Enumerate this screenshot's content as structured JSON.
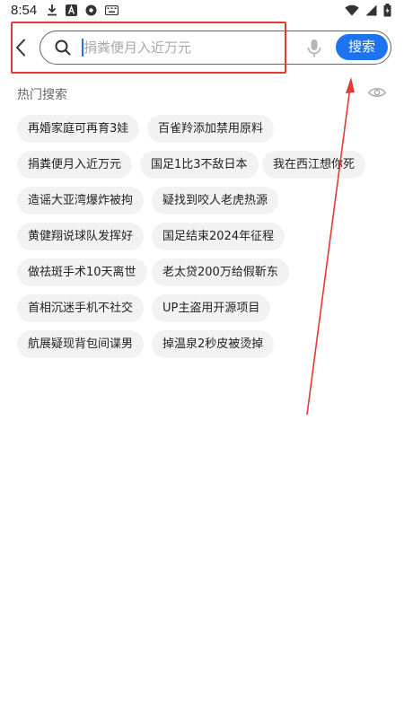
{
  "status_bar": {
    "time": "8:54",
    "left_icons": [
      "download-icon",
      "text-a-icon",
      "record-icon",
      "keyboard-icon"
    ],
    "right_icons": [
      "wifi-icon",
      "signal-icon",
      "battery-icon"
    ]
  },
  "search": {
    "placeholder": "捐粪便月入近万元",
    "value": "",
    "button_label": "搜索"
  },
  "hot_search": {
    "title": "热门搜索",
    "rows": [
      [
        "再婚家庭可再育3娃",
        "百雀羚添加禁用原料"
      ],
      [
        "捐粪便月入近万元",
        "国足1比3不敌日本",
        "我在西江想你死"
      ],
      [
        "造谣大亚湾爆炸被拘",
        "疑找到咬人老虎热源"
      ],
      [
        "黄健翔说球队发挥好",
        "国足结束2024年征程"
      ],
      [
        "做祛斑手术10天离世",
        "老太贷200万给假靳东"
      ],
      [
        "首相沉迷手机不社交",
        "UP主盗用开源项目"
      ],
      [
        "航展疑现背包间谍男",
        "掉温泉2秒皮被烫掉"
      ]
    ]
  },
  "colors": {
    "accent": "#1e74f0",
    "annotation": "#e53935",
    "tag_bg": "#f2f2f2"
  }
}
